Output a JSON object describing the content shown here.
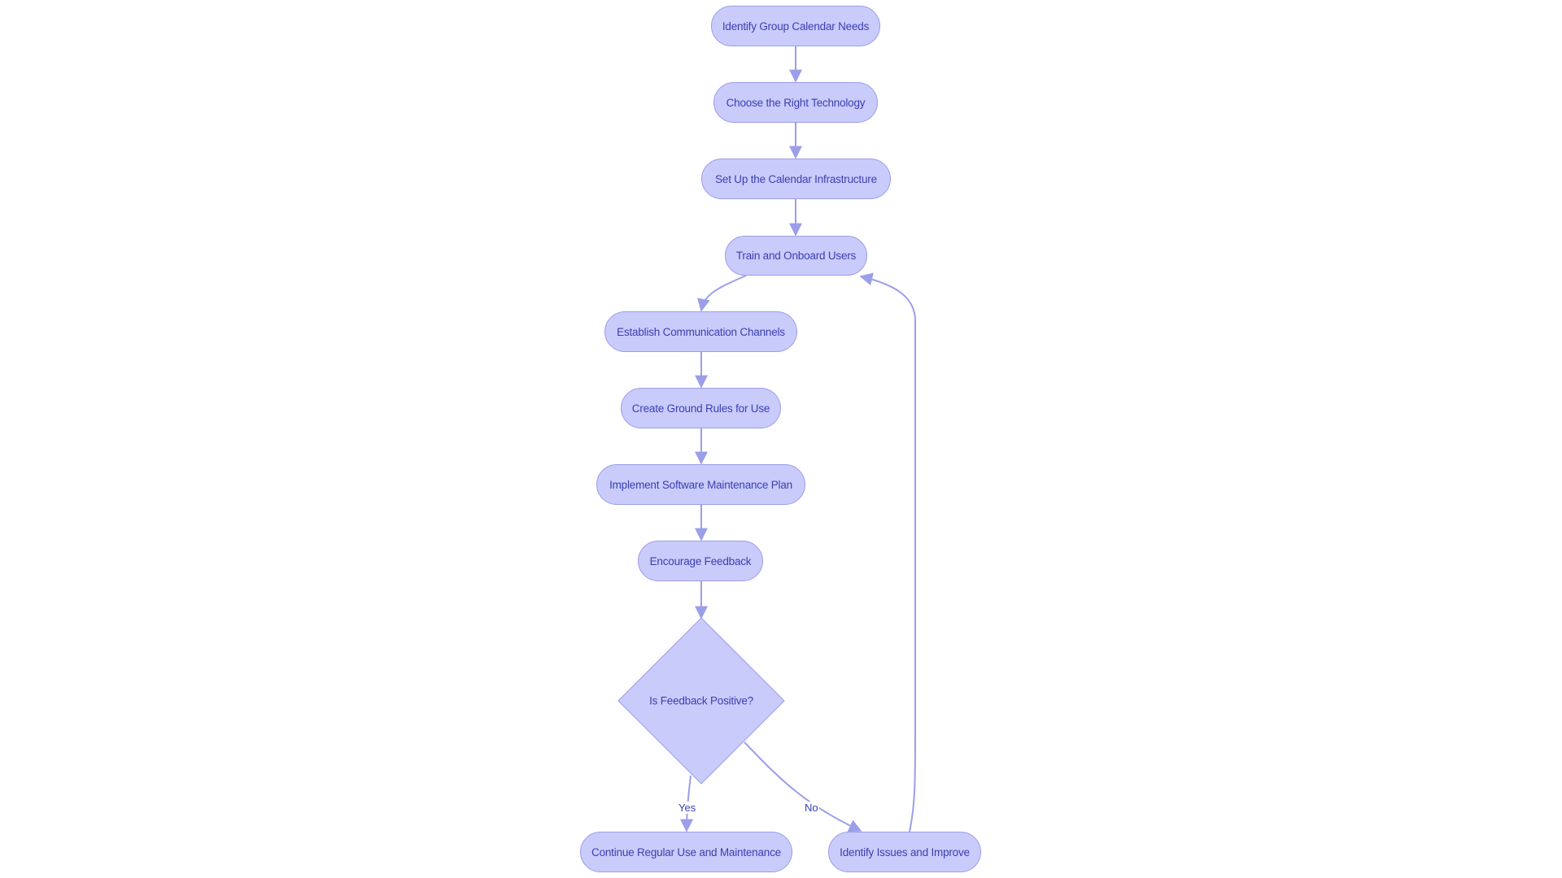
{
  "diagram": {
    "type": "flowchart",
    "colors": {
      "node_fill": "#c9cbfb",
      "node_stroke": "#9b9ee8",
      "edge": "#9b9ee8",
      "text": "#3a3fb0"
    },
    "nodes": {
      "n1": "Identify Group Calendar Needs",
      "n2": "Choose the Right Technology",
      "n3": "Set Up the Calendar Infrastructure",
      "n4": "Train and Onboard Users",
      "n5": "Establish Communication Channels",
      "n6": "Create Ground Rules for Use",
      "n7": "Implement Software Maintenance Plan",
      "n8": "Encourage Feedback",
      "n9": "Is Feedback Positive?",
      "n10": "Continue Regular Use and Maintenance",
      "n11": "Identify Issues and Improve"
    },
    "edges": [
      {
        "from": "n1",
        "to": "n2",
        "label": ""
      },
      {
        "from": "n2",
        "to": "n3",
        "label": ""
      },
      {
        "from": "n3",
        "to": "n4",
        "label": ""
      },
      {
        "from": "n4",
        "to": "n5",
        "label": ""
      },
      {
        "from": "n5",
        "to": "n6",
        "label": ""
      },
      {
        "from": "n6",
        "to": "n7",
        "label": ""
      },
      {
        "from": "n7",
        "to": "n8",
        "label": ""
      },
      {
        "from": "n8",
        "to": "n9",
        "label": ""
      },
      {
        "from": "n9",
        "to": "n10",
        "label": "Yes"
      },
      {
        "from": "n9",
        "to": "n11",
        "label": "No"
      },
      {
        "from": "n11",
        "to": "n4",
        "label": ""
      }
    ],
    "edge_labels": {
      "yes": "Yes",
      "no": "No"
    }
  }
}
